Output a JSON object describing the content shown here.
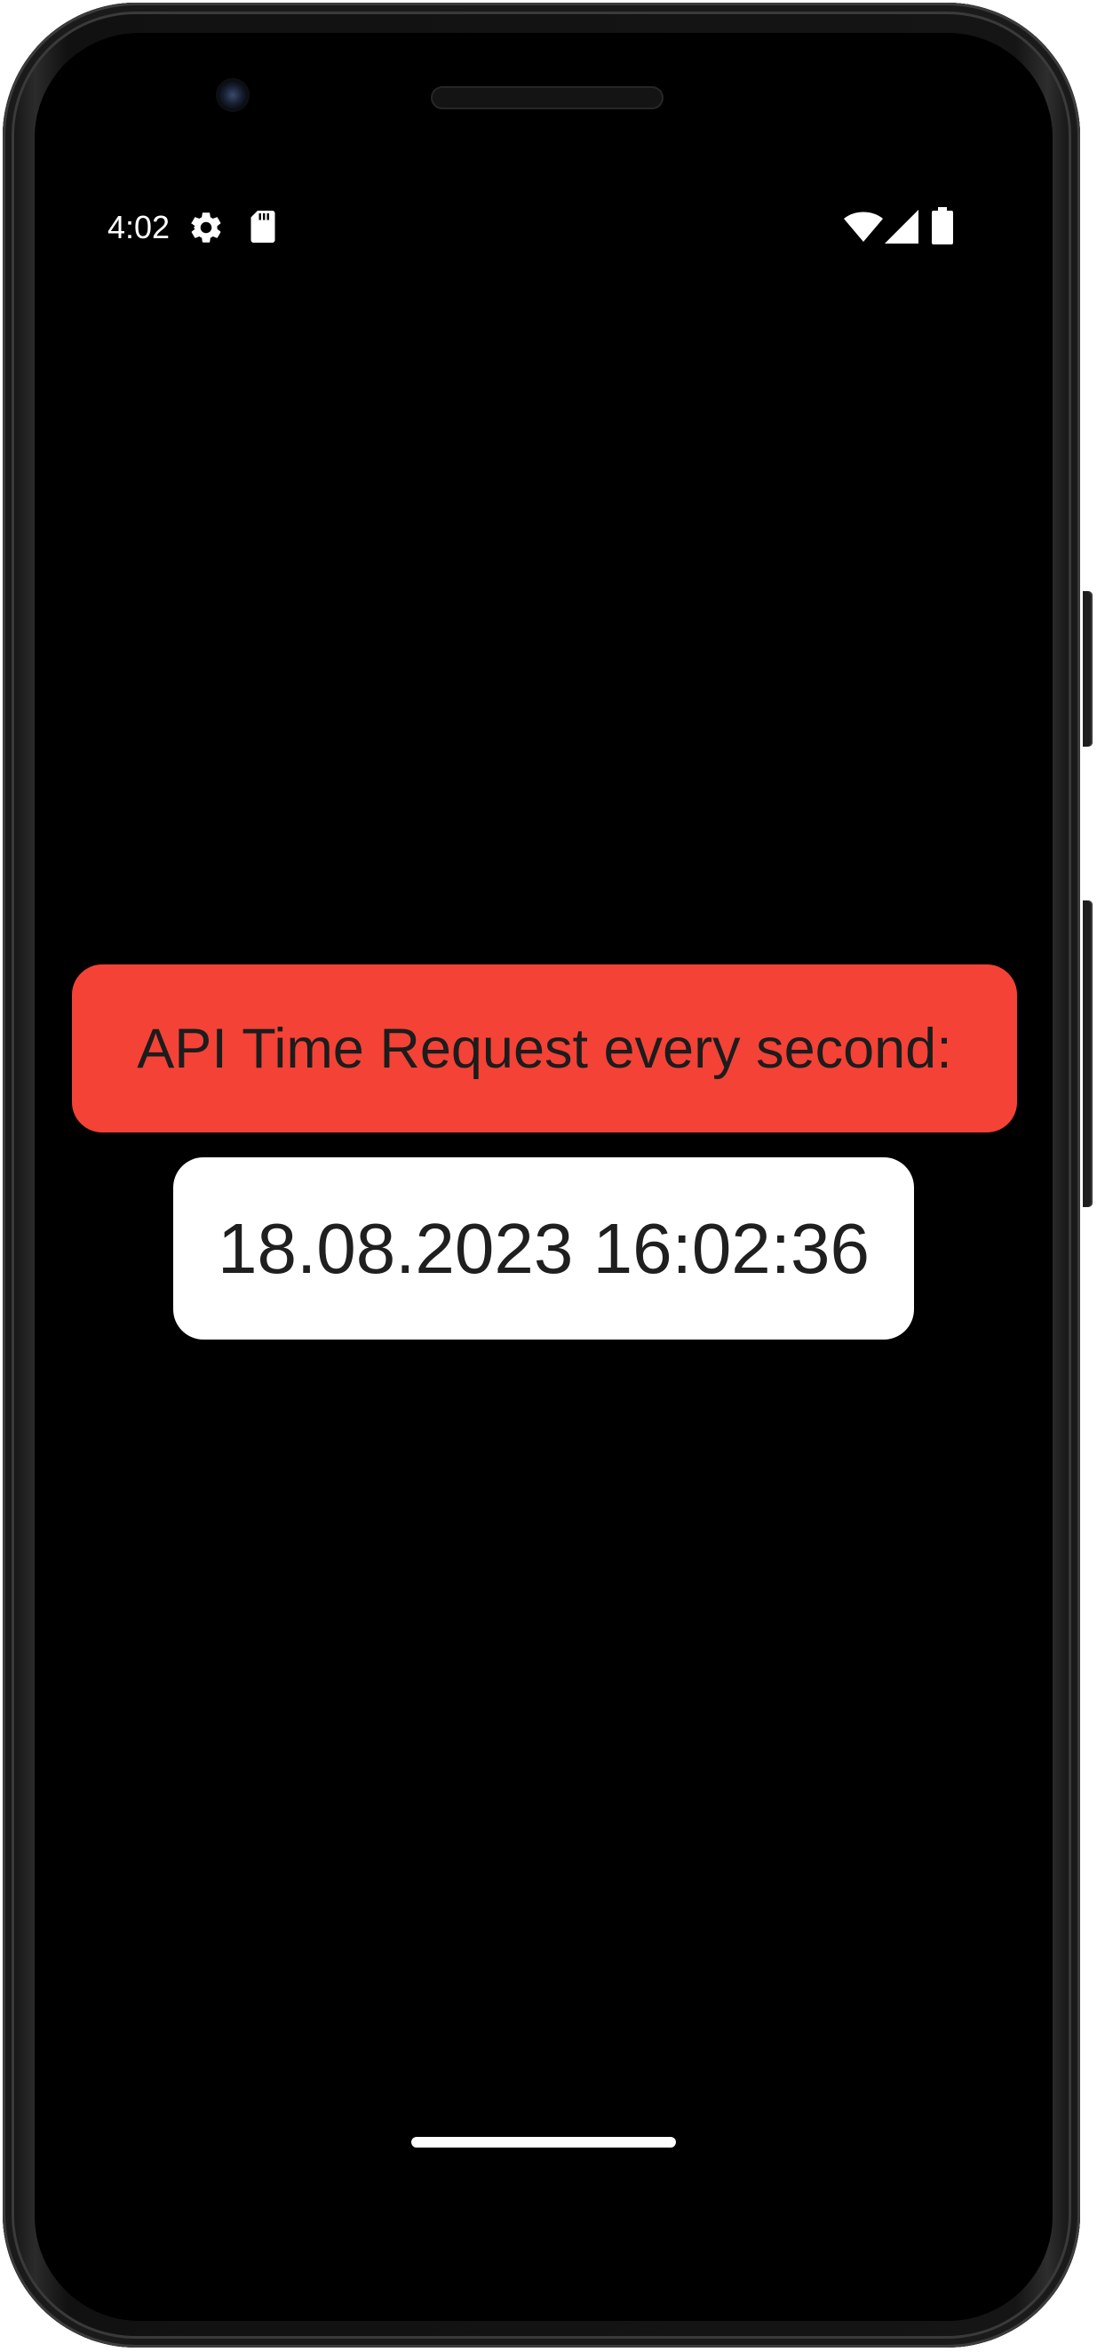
{
  "status_bar": {
    "time": "4:02",
    "icons": [
      "gear-icon",
      "sd-card-icon",
      "wifi-icon",
      "signal-icon",
      "battery-icon"
    ]
  },
  "app": {
    "title": "API Time Request every second:",
    "datetime": "18.08.2023 16:02:36"
  },
  "colors": {
    "screen_background": "#000000",
    "title_box": "#f44236",
    "time_box": "#ffffff",
    "status_text": "#ffffff"
  }
}
